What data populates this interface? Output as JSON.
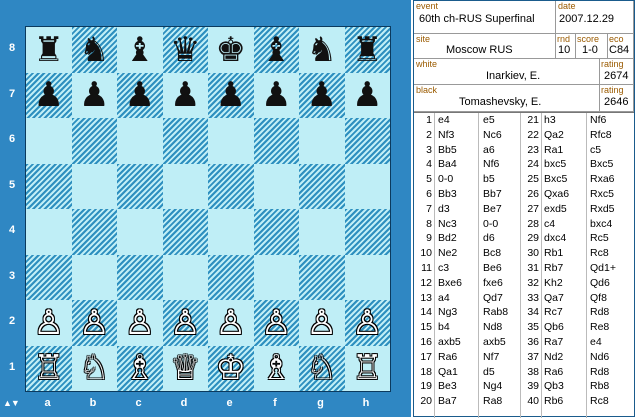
{
  "board": {
    "ranks": [
      "8",
      "7",
      "6",
      "5",
      "4",
      "3",
      "2",
      "1"
    ],
    "files": [
      "a",
      "b",
      "c",
      "d",
      "e",
      "f",
      "g",
      "h"
    ],
    "flip_glyph": "▲▼",
    "position": [
      [
        "♜",
        "♞",
        "♝",
        "♛",
        "♚",
        "♝",
        "♞",
        "♜"
      ],
      [
        "♟",
        "♟",
        "♟",
        "♟",
        "♟",
        "♟",
        "♟",
        "♟"
      ],
      [
        "",
        "",
        "",
        "",
        "",
        "",
        "",
        ""
      ],
      [
        "",
        "",
        "",
        "",
        "",
        "",
        "",
        ""
      ],
      [
        "",
        "",
        "",
        "",
        "",
        "",
        "",
        ""
      ],
      [
        "",
        "",
        "",
        "",
        "",
        "",
        "",
        ""
      ],
      [
        "♙",
        "♙",
        "♙",
        "♙",
        "♙",
        "♙",
        "♙",
        "♙"
      ],
      [
        "♖",
        "♘",
        "♗",
        "♕",
        "♔",
        "♗",
        "♘",
        "♖"
      ]
    ],
    "colors": {
      "frame": "#2f87c3",
      "light": "#bfeef6",
      "dark": "#2d8fbf"
    }
  },
  "game": {
    "event_label": "event",
    "event": "60th ch-RUS Superfinal",
    "date_label": "date",
    "date": "2007.12.29",
    "site_label": "site",
    "site": "Moscow RUS",
    "rnd_label": "rnd",
    "rnd": "10",
    "score_label": "score",
    "score": "1-0",
    "eco_label": "eco",
    "eco": "C84",
    "white_label": "white",
    "white": "Inarkiev, E.",
    "black_label": "black",
    "black": "Tomashevsky, E.",
    "rating_label": "rating",
    "white_rating": "2674",
    "black_rating": "2646"
  },
  "moves": [
    [
      "1",
      "e4",
      "e5",
      "21",
      "h3",
      "Nf6"
    ],
    [
      "2",
      "Nf3",
      "Nc6",
      "22",
      "Qa2",
      "Rfc8"
    ],
    [
      "3",
      "Bb5",
      "a6",
      "23",
      "Ra1",
      "c5"
    ],
    [
      "4",
      "Ba4",
      "Nf6",
      "24",
      "bxc5",
      "Bxc5"
    ],
    [
      "5",
      "0-0",
      "b5",
      "25",
      "Bxc5",
      "Rxa6"
    ],
    [
      "6",
      "Bb3",
      "Bb7",
      "26",
      "Qxa6",
      "Rxc5"
    ],
    [
      "7",
      "d3",
      "Be7",
      "27",
      "exd5",
      "Rxd5"
    ],
    [
      "8",
      "Nc3",
      "0-0",
      "28",
      "c4",
      "bxc4"
    ],
    [
      "9",
      "Bd2",
      "d6",
      "29",
      "dxc4",
      "Rc5"
    ],
    [
      "10",
      "Ne2",
      "Bc8",
      "30",
      "Rb1",
      "Rc8"
    ],
    [
      "11",
      "c3",
      "Be6",
      "31",
      "Rb7",
      "Qd1+"
    ],
    [
      "12",
      "Bxe6",
      "fxe6",
      "32",
      "Kh2",
      "Qd6"
    ],
    [
      "13",
      "a4",
      "Qd7",
      "33",
      "Qa7",
      "Qf8"
    ],
    [
      "14",
      "Ng3",
      "Rab8",
      "34",
      "Rc7",
      "Rd8"
    ],
    [
      "15",
      "b4",
      "Nd8",
      "35",
      "Qb6",
      "Re8"
    ],
    [
      "16",
      "axb5",
      "axb5",
      "36",
      "Ra7",
      "e4"
    ],
    [
      "17",
      "Ra6",
      "Nf7",
      "37",
      "Nd2",
      "Nd6"
    ],
    [
      "18",
      "Qa1",
      "d5",
      "38",
      "Ra6",
      "Rd8"
    ],
    [
      "19",
      "Be3",
      "Ng4",
      "39",
      "Qb3",
      "Rb8"
    ],
    [
      "20",
      "Ba7",
      "Ra8",
      "40",
      "Rb6",
      "Rc8"
    ]
  ]
}
